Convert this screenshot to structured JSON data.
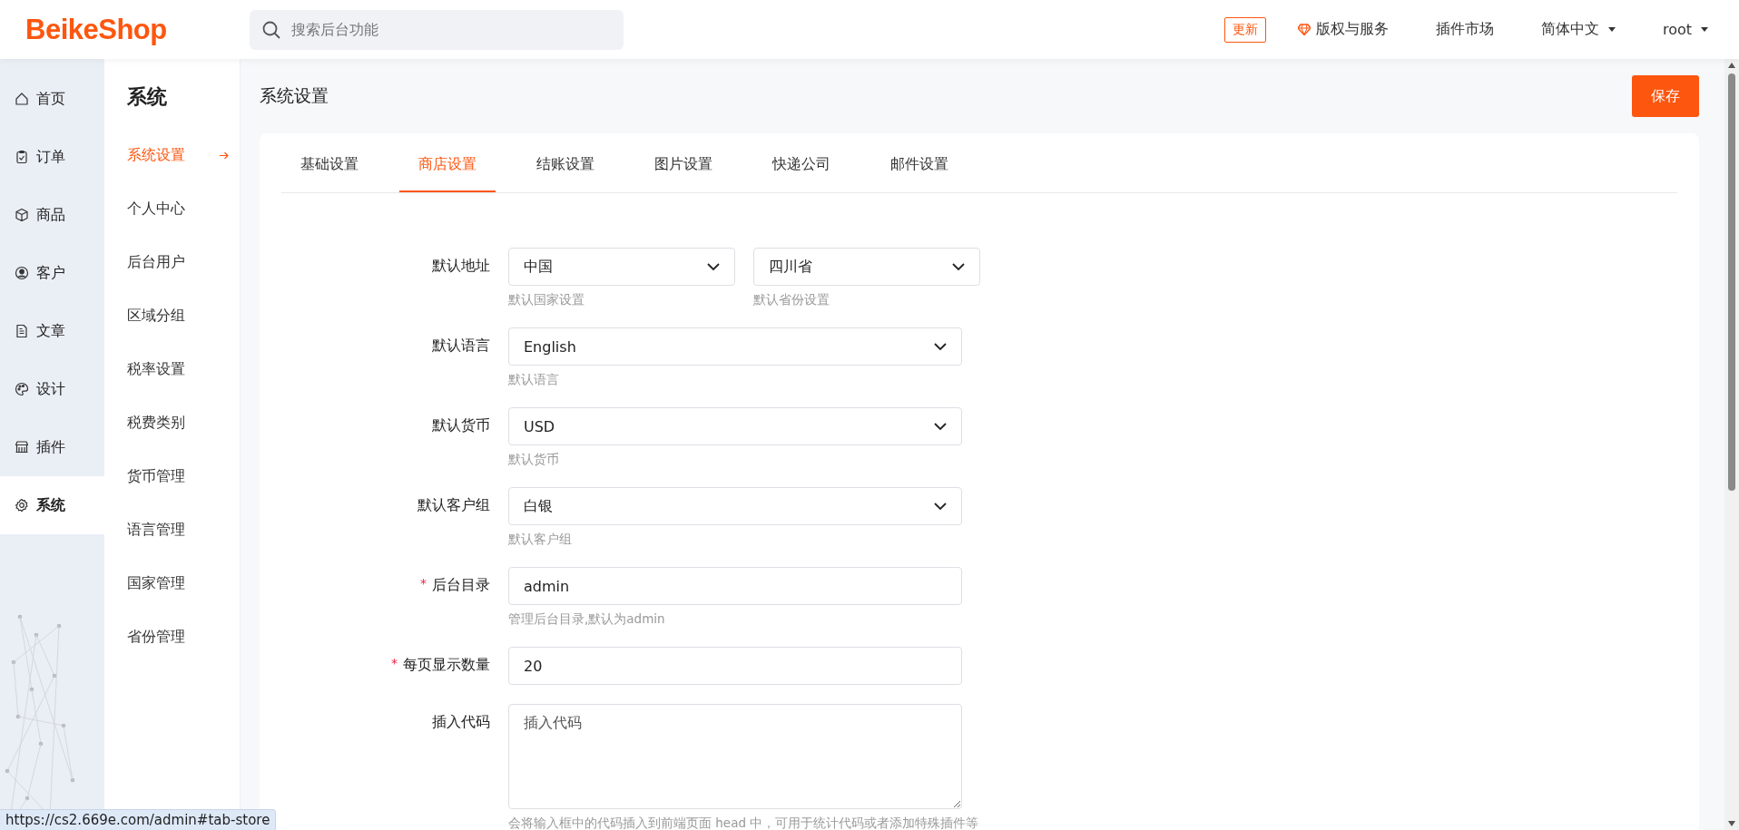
{
  "header": {
    "logo": "BeikeShop",
    "search": {
      "placeholder": "搜索后台功能"
    },
    "update_badge": "更新",
    "links": [
      {
        "label": "版权与服务",
        "kind": "icon"
      },
      {
        "label": "插件市场",
        "kind": "plain"
      },
      {
        "label": "简体中文",
        "kind": "dropdown"
      },
      {
        "label": "root",
        "kind": "dropdown"
      }
    ]
  },
  "nav_rail": {
    "items": [
      {
        "label": "首页",
        "kind": "home",
        "selected": false
      },
      {
        "label": "订单",
        "kind": "order",
        "selected": false
      },
      {
        "label": "商品",
        "kind": "product",
        "selected": false
      },
      {
        "label": "客户",
        "kind": "customer",
        "selected": false
      },
      {
        "label": "文章",
        "kind": "article",
        "selected": false
      },
      {
        "label": "设计",
        "kind": "design",
        "selected": false
      },
      {
        "label": "插件",
        "kind": "plugin",
        "selected": false
      },
      {
        "label": "系统",
        "kind": "system",
        "selected": true
      }
    ]
  },
  "sub_menu": {
    "title": "系统",
    "items": [
      {
        "label": "系统设置",
        "selected": true
      },
      {
        "label": "个人中心",
        "selected": false
      },
      {
        "label": "后台用户",
        "selected": false
      },
      {
        "label": "区域分组",
        "selected": false
      },
      {
        "label": "税率设置",
        "selected": false
      },
      {
        "label": "税费类别",
        "selected": false
      },
      {
        "label": "货币管理",
        "selected": false
      },
      {
        "label": "语言管理",
        "selected": false
      },
      {
        "label": "国家管理",
        "selected": false
      },
      {
        "label": "省份管理",
        "selected": false
      }
    ]
  },
  "page": {
    "title": "系统设置",
    "save_button": "保存",
    "tabs": [
      {
        "label": "基础设置",
        "selected": false
      },
      {
        "label": "商店设置",
        "selected": true
      },
      {
        "label": "结账设置",
        "selected": false
      },
      {
        "label": "图片设置",
        "selected": false
      },
      {
        "label": "快递公司",
        "selected": false
      },
      {
        "label": "邮件设置",
        "selected": false
      }
    ],
    "form": [
      {
        "label": "默认地址",
        "fields": [
          {
            "kind": "select",
            "value": "中国",
            "hint": "默认国家设置"
          },
          {
            "kind": "select",
            "value": "四川省",
            "hint": "默认省份设置"
          }
        ]
      },
      {
        "label": "默认语言",
        "fields": [
          {
            "kind": "select",
            "value": "English",
            "hint": "默认语言"
          }
        ]
      },
      {
        "label": "默认货币",
        "fields": [
          {
            "kind": "select",
            "value": "USD",
            "hint": "默认货币"
          }
        ]
      },
      {
        "label": "默认客户组",
        "fields": [
          {
            "kind": "select",
            "value": "白银",
            "hint": "默认客户组"
          }
        ]
      },
      {
        "label": "后台目录",
        "required_mark": "*",
        "fields": [
          {
            "kind": "text",
            "value": "admin",
            "hint": "管理后台目录,默认为admin"
          }
        ]
      },
      {
        "label": "每页显示数量",
        "required_mark": "*",
        "fields": [
          {
            "kind": "text",
            "value": "20"
          }
        ]
      },
      {
        "label": "插入代码",
        "fields": [
          {
            "kind": "textarea",
            "placeholder": "插入代码",
            "hint": "会将输入框中的代码插入到前端页面 head 中，可用于统计代码或者添加特殊插件等"
          }
        ]
      }
    ]
  },
  "status_url": "https://cs2.669e.com/admin#tab-store"
}
